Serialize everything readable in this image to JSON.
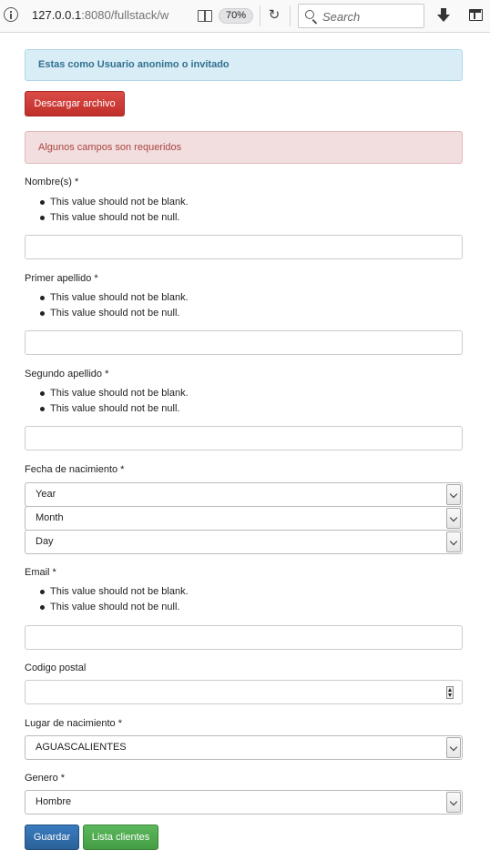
{
  "browser": {
    "url_host": "127.0.0.1",
    "url_rest": ":8080/fullstack/w",
    "zoom": "70%",
    "search_placeholder": "Search"
  },
  "info_alert": "Estas como Usuario anonimo o invitado",
  "download_button": "Descargar archivo",
  "error_alert": "Algunos campos son requeridos",
  "errors": {
    "blank": "This value should not be blank.",
    "null": "This value should not be null."
  },
  "fields": {
    "nombre": "Nombre(s) *",
    "primer_apellido": "Primer apellido *",
    "segundo_apellido": "Segundo apellido *",
    "fecha_nacimiento": "Fecha de nacimiento *",
    "year": "Year",
    "month": "Month",
    "day": "Day",
    "email": "Email *",
    "codigo_postal": "Codigo postal",
    "lugar_nacimiento": "Lugar de nacimiento *",
    "lugar_value": "AGUASCALIENTES",
    "genero": "Genero *",
    "genero_value": "Hombre"
  },
  "buttons": {
    "guardar": "Guardar",
    "lista_clientes": "Lista clientes"
  }
}
